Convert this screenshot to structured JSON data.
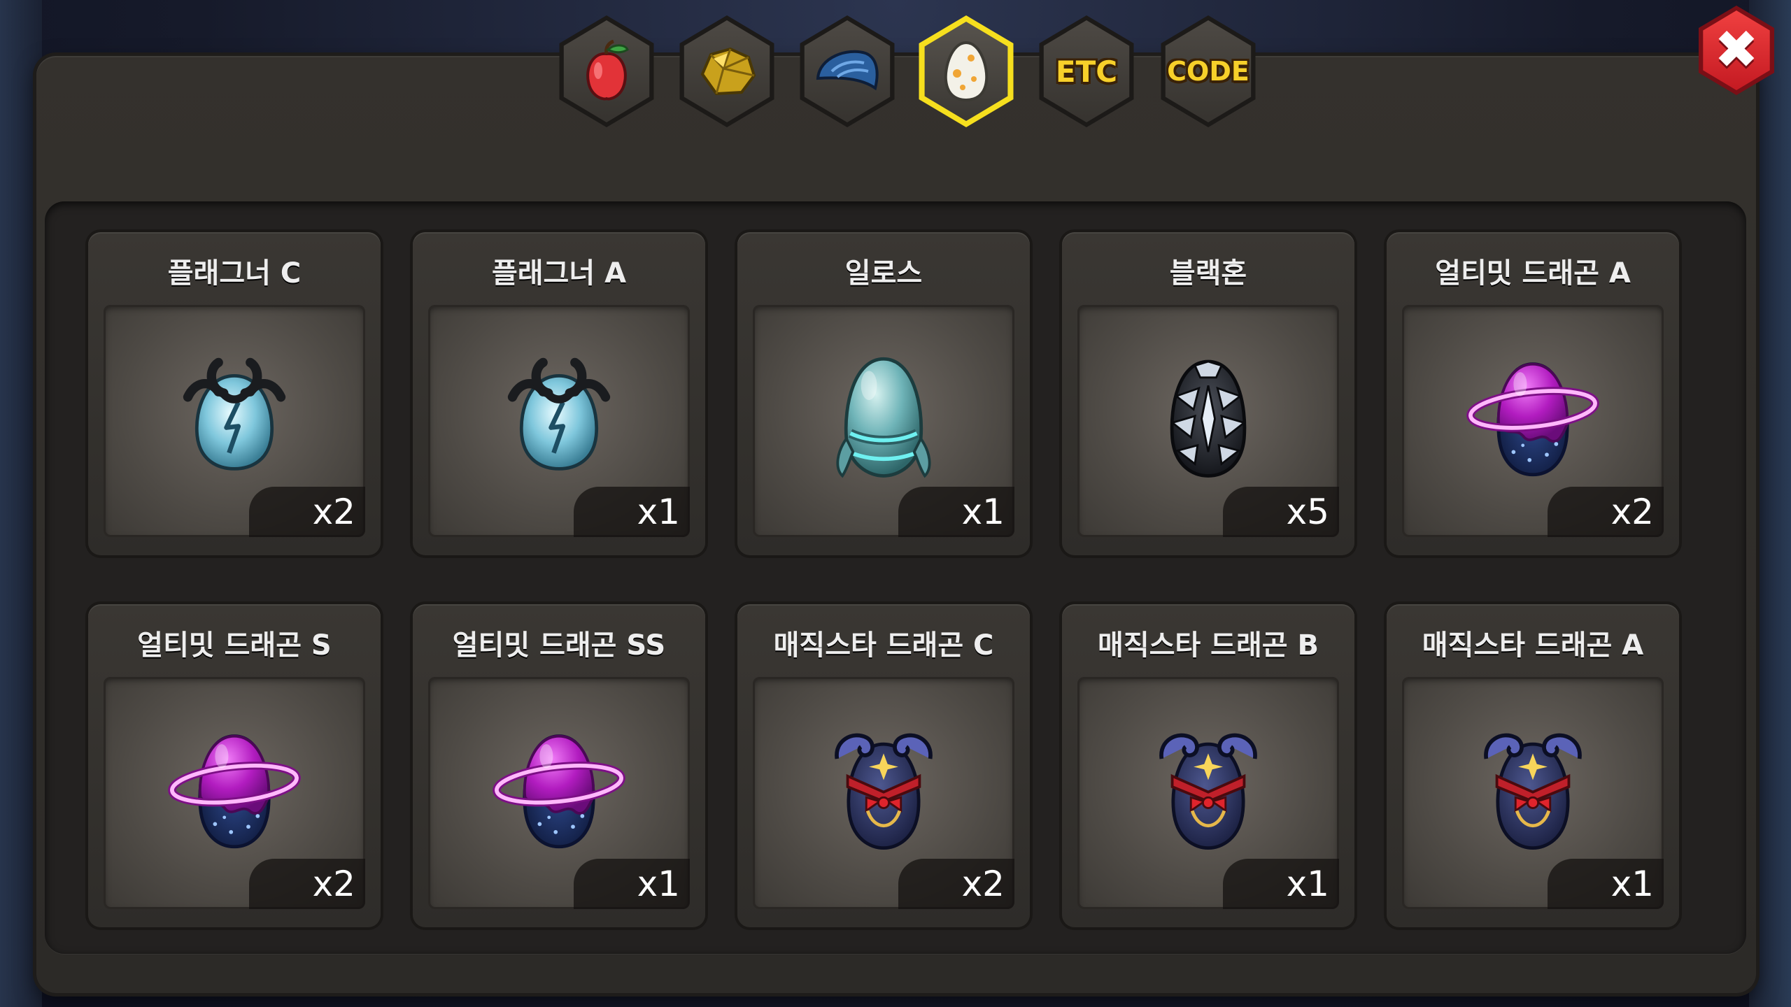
{
  "tabs": [
    {
      "icon": "fruit-icon",
      "label": ""
    },
    {
      "icon": "gold-ore-icon",
      "label": ""
    },
    {
      "icon": "dragon-scale-icon",
      "label": ""
    },
    {
      "icon": "egg-icon",
      "label": "",
      "active": true
    },
    {
      "icon": "",
      "label": "ETC"
    },
    {
      "icon": "",
      "label": "CODE"
    }
  ],
  "close_label": "✖",
  "items": [
    {
      "name": "플래그너 C",
      "qty": "x2",
      "egg": "flagner"
    },
    {
      "name": "플래그너 A",
      "qty": "x1",
      "egg": "flagner"
    },
    {
      "name": "일로스",
      "qty": "x1",
      "egg": "ilos"
    },
    {
      "name": "블랙혼",
      "qty": "x5",
      "egg": "blackhorn"
    },
    {
      "name": "얼티밋 드래곤 A",
      "qty": "x2",
      "egg": "ultimate"
    },
    {
      "name": "얼티밋 드래곤 S",
      "qty": "x2",
      "egg": "ultimate"
    },
    {
      "name": "얼티밋 드래곤 SS",
      "qty": "x1",
      "egg": "ultimate"
    },
    {
      "name": "매직스타 드래곤 C",
      "qty": "x2",
      "egg": "magicstar"
    },
    {
      "name": "매직스타 드래곤 B",
      "qty": "x1",
      "egg": "magicstar"
    },
    {
      "name": "매직스타 드래곤 A",
      "qty": "x1",
      "egg": "magicstar"
    }
  ],
  "colors": {
    "active_tab_border": "#f6df1e",
    "tab_text": "#f7d02a",
    "close_red": "#d8242c",
    "ultimate_purple": "#b21cc0",
    "ultimate_ring": "#ff7cf4",
    "ilos_teal": "#6fb4b8",
    "magicstar_navy": "#252c58"
  }
}
